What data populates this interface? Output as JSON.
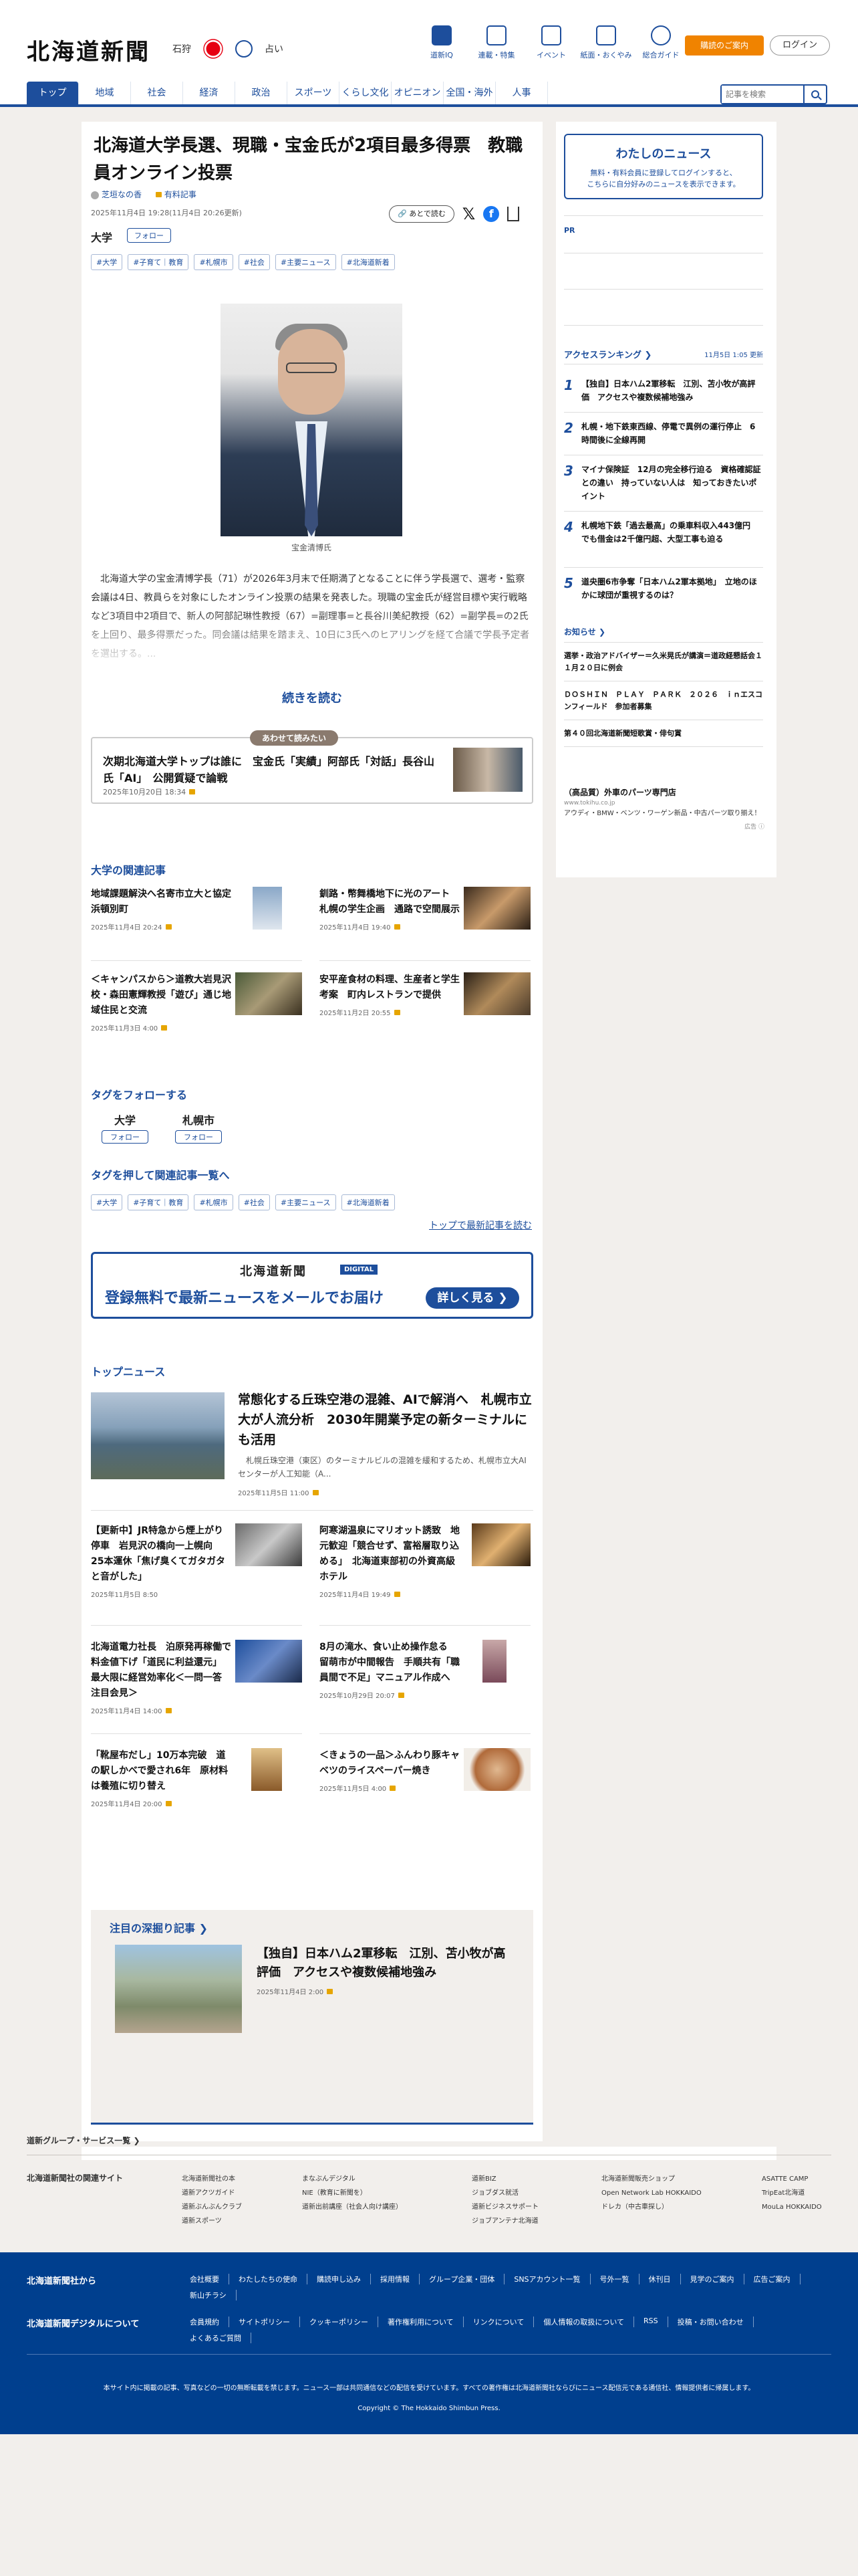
{
  "header": {
    "logo": "北海道新聞",
    "region": "石狩",
    "fortune_label": "占い",
    "icons": [
      {
        "label": "道新IQ",
        "icon": "bookmark-icon"
      },
      {
        "label": "連載・特集",
        "icon": "flag-icon"
      },
      {
        "label": "イベント",
        "icon": "calendar-icon"
      },
      {
        "label": "紙面・おくやみ",
        "icon": "newspaper-icon"
      },
      {
        "label": "総合ガイド",
        "icon": "help-icon"
      }
    ],
    "subscribe": "購読のご案内",
    "login": "ログイン",
    "nav": [
      "トップ",
      "地域",
      "社会",
      "経済",
      "政治",
      "スポーツ",
      "くらし文化",
      "オピニオン",
      "全国・海外",
      "人事"
    ],
    "search_placeholder": "記事を検索"
  },
  "article": {
    "title": "北海道大学長選、現職・宝金氏が2項目最多得票　教職員オンライン投票",
    "author": "芝垣なの香",
    "paid": "有料記事",
    "date": "2025年11月4日 19:28(11月4日 20:26更新)",
    "read_later": "あとで読む",
    "category": "大学",
    "follow": "フォロー",
    "tags": [
      "#大学",
      "#子育て｜教育",
      "#札幌市",
      "#社会",
      "#主要ニュース",
      "#北海道新着"
    ],
    "caption": "宝金清博氏",
    "body": "北海道大学の宝金清博学長（71）が2026年3月末で任期満了となることに伴う学長選で、選考・監察会議は4日、教員らを対象にしたオンライン投票の結果を発表した。現職の宝金氏が経営目標や実行戦略など3項目中2項目で、新人の阿部記琳性教授（67）=副理事=と長谷川美紀教授（62）=副学長=の2氏を上回り、最多得票だった。同会議は結果を踏まえ、10日に3氏へのヒアリングを経て合議で学長予定者を選出する。...",
    "read_more": "続きを読む"
  },
  "related_box": {
    "label": "あわせて読みたい",
    "title": "次期北海道大学トップは誰に　宝金氏「実績」阿部氏「対話」長谷山氏「AI」　公開質疑で論戦",
    "date": "2025年10月20日 18:34"
  },
  "univ_related": {
    "heading": "大学の関連記事",
    "items": [
      {
        "title": "地域課題解決へ名寄市立大と協定　浜頓別町",
        "date": "2025年11月4日 20:24"
      },
      {
        "title": "釧路・幣舞橋地下に光のアート　札幌の学生企画　通路で空間展示",
        "date": "2025年11月4日 19:40"
      },
      {
        "title": "＜キャンパスから＞道教大岩見沢校・森田憲輝教授「遊び」通じ地域住民と交流",
        "date": "2025年11月3日 4:00"
      },
      {
        "title": "安平産食材の料理、生産者と学生考案　町内レストランで提供",
        "date": "2025年11月2日 20:55"
      }
    ]
  },
  "follow_tags": {
    "heading": "タグをフォローする",
    "items": [
      {
        "name": "大学",
        "btn": "フォロー"
      },
      {
        "name": "札幌市",
        "btn": "フォロー"
      }
    ]
  },
  "tag_search": {
    "heading": "タグを押して関連記事一覧へ",
    "tags": [
      "#大学",
      "#子育て｜教育",
      "#札幌市",
      "#社会",
      "#主要ニュース",
      "#北海道新着"
    ],
    "more": "トップで最新記事を読む"
  },
  "mail_banner": {
    "logo": "北海道新聞",
    "digital": "DIGITAL",
    "text": "登録無料で最新ニュースをメールでお届け",
    "button": "詳しく見る ❯"
  },
  "top_news": {
    "heading": "トップニュース",
    "lead": {
      "title": "常態化する丘珠空港の混雑、AIで解消へ　札幌市立大が人流分析　2030年開業予定の新ターミナルにも活用",
      "summary": "札幌丘珠空港（東区）のターミナルビルの混雑を緩和するため、札幌市立大AIセンターが人工知能（A...",
      "date": "2025年11月5日 11:00"
    },
    "items": [
      {
        "title": "【更新中】JR特急から煙上がり停車　岩見沢の橋向一上幌向　25本運休「焦げ臭くてガタガタと音がした」",
        "date": "2025年11月5日 8:50"
      },
      {
        "title": "阿寒湖温泉にマリオット誘致　地元歓迎「競合せず、富裕層取り込める」　北海道東部初の外資高級ホテル",
        "date": "2025年11月4日 19:49"
      },
      {
        "title": "北海道電力社長　泊原発再稼働で料金値下げ「道民に利益還元」　最大限に経営効率化＜一問一答　注目会見＞",
        "date": "2025年11月4日 14:00"
      },
      {
        "title": "8月の滝水、食い止め操作怠る　留萌市が中間報告　手順共有「職員間で不足」マニュアル作成へ",
        "date": "2025年10月29日 20:07"
      },
      {
        "title": "「靴屋布だし」10万本完破　道の駅しかべで愛され6年　原材料は養殖に切り替え",
        "date": "2025年11月4日 20:00"
      },
      {
        "title": "＜きょうの一品＞ふんわり豚キャベツのライスペーパー焼き",
        "date": "2025年11月5日 4:00"
      }
    ]
  },
  "deep": {
    "heading": "注目の深掘り記事 ❯",
    "title": "【独自】日本ハム2軍移転　江別、苫小牧が高評価　アクセスや複数候補地強み",
    "date": "2025年11月4日 2:00"
  },
  "sidebar": {
    "mynews_title": "わたしのニュース",
    "mynews_desc1": "無料・有料会員に登録してログインすると、",
    "mynews_desc2": "こちらに自分好みのニュースを表示できます。",
    "pr": "PR",
    "ranking_title": "アクセスランキング ❯",
    "ranking_updated": "11月5日 1:05 更新",
    "ranking": [
      {
        "n": "1",
        "t": "【独自】日本ハム2軍移転　江別、苫小牧が高評価　アクセスや複数候補地強み"
      },
      {
        "n": "2",
        "t": "札幌・地下鉄東西線、停電で異例の運行停止　6時間後に全線再開"
      },
      {
        "n": "3",
        "t": "マイナ保険証　12月の完全移行迫る　資格確認証との違い　持っていない人は　知っておきたいポイント"
      },
      {
        "n": "4",
        "t": "札幌地下鉄「過去最高」の乗車料収入443億円　でも借金は2千億円超、大型工事も迫る"
      },
      {
        "n": "5",
        "t": "道央圏6市争奪「日本ハム2軍本拠地」　立地のほかに球団が重視するのは？"
      }
    ],
    "notice_title": "お知らせ ❯",
    "notices": [
      "選挙・政治アドバイザー＝久米晃氏が講演＝道政経懇話会１１月２０日に例会",
      "ＤＯＳＨＩＮ　ＰＬＡＹ　ＰＡＲＫ　２０２６　ｉｎエスコンフィールド　参加者募集",
      "第４０回北海道新聞短歌賞・俳句賞"
    ],
    "ad_title": "（高品質）外車のパーツ専門店",
    "ad_url": "www.tokihu.co.jp",
    "ad_text": "アウディ・BMW・ベンツ・ワーゲン新品・中古パーツ取り揃え！",
    "ad_label": "広告 ⓘ"
  },
  "footer": {
    "group": "道新グループ・サービス一覧 ❯",
    "related_h": "北海道新聞社の関連サイト",
    "related_cols": [
      [
        "北海道新聞社の本",
        "道新アクツガイド",
        "道新ぶんぶんクラブ",
        "道新スポーツ"
      ],
      [
        "まなぶんデジタル",
        "NIE（教育に新聞を）",
        "道新出前講座（社会人向け講座）"
      ],
      [
        "道新BIZ",
        "ジョブダス就活",
        "道新ビジネスサポート",
        "ジョブアンテナ北海道"
      ],
      [
        "北海道新聞販売ショップ",
        "Open Network Lab HOKKAIDO",
        "ドレカ（中古車探し）"
      ],
      [
        "ASATTE CAMP",
        "TripEat北海道",
        "MouLa HOKKAIDO"
      ]
    ],
    "company_h": "北海道新聞社から",
    "company_links": [
      "会社概要",
      "わたしたちの使命",
      "購読申し込み",
      "採用情報",
      "グループ企業・団体",
      "SNSアカウント一覧",
      "号外一覧",
      "休刊日",
      "見学のご案内",
      "広告ご案内",
      "新山チラシ"
    ],
    "digital_h": "北海道新聞デジタルについて",
    "digital_links": [
      "会員規約",
      "サイトポリシー",
      "クッキーポリシー",
      "著作権利用について",
      "リンクについて",
      "個人情報の取扱について",
      "RSS",
      "投稿・お問い合わせ",
      "よくあるご質問"
    ],
    "note": "本サイト内に掲載の記事、写真などの一切の無断転載を禁じます。ニュース一部は共同通信などの配信を受けています。すべての著作権は北海道新聞社ならびにニュース配信元である通信社、情報提供者に帰属します。",
    "copyright": "Copyright © The Hokkaido Shimbun Press."
  },
  "colors": {
    "brand": "#1d4e9c",
    "orange": "#f08300",
    "bg": "#f2efec"
  }
}
